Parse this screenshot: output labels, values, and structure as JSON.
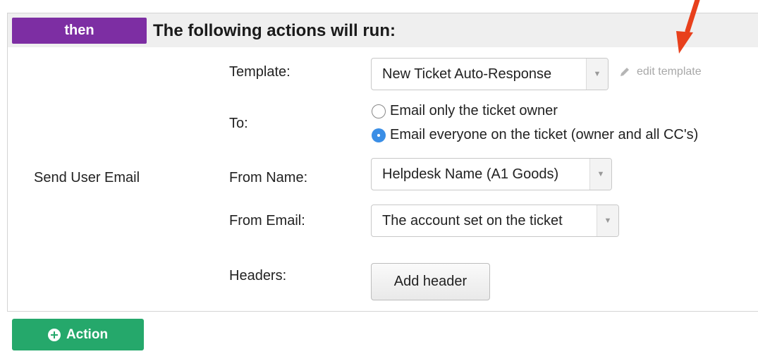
{
  "header": {
    "badge_label": "then",
    "title": "The following actions will run:"
  },
  "action": {
    "type_label": "Send User Email",
    "template": {
      "label": "Template:",
      "selected": "New Ticket Auto-Response",
      "edit_link": "edit template"
    },
    "to": {
      "label": "To:",
      "options": [
        {
          "label": "Email only the ticket owner",
          "checked": false
        },
        {
          "label": "Email everyone on the ticket (owner and all CC's)",
          "checked": true
        }
      ]
    },
    "from_name": {
      "label": "From Name:",
      "selected": "Helpdesk Name (A1 Goods)"
    },
    "from_email": {
      "label": "From Email:",
      "selected": "The account set on the ticket"
    },
    "headers": {
      "label": "Headers:",
      "add_button": "Add header"
    }
  },
  "footer": {
    "add_action_label": "Action"
  },
  "colors": {
    "then_badge": "#7d2ea3",
    "action_button": "#25a86b",
    "radio_checked": "#3a8ee6",
    "annotation_arrow": "#e8401c"
  },
  "icons": {
    "dropdown": "chevron-down-icon",
    "edit": "pencil-icon",
    "add": "plus-circle-icon",
    "annotation": "red-arrow-icon"
  }
}
